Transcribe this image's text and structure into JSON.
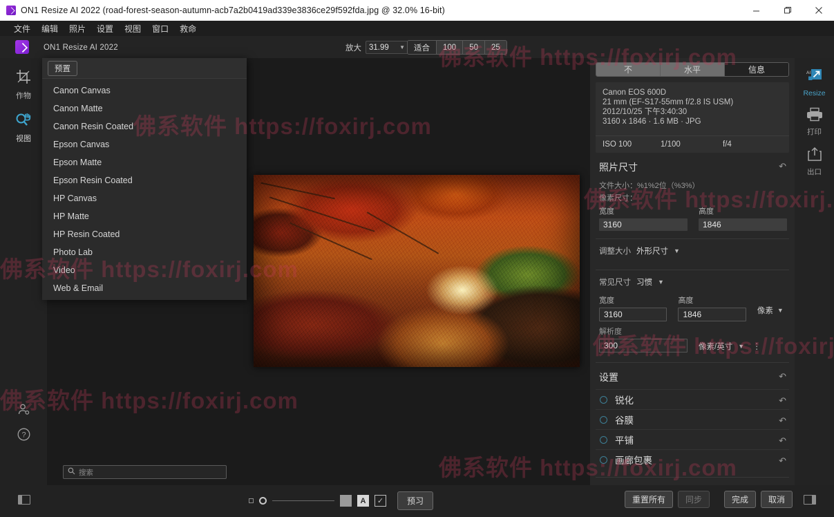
{
  "window": {
    "title": "ON1 Resize AI 2022 (road-forest-season-autumn-acb7a2b0419ad339e3836ce29f592fda.jpg @ 32.0% 16-bit)",
    "app_icon": "on1-logo-icon",
    "minimize": "─",
    "maximize": "❐",
    "close": "✕"
  },
  "menubar": {
    "items": [
      {
        "label": "文件"
      },
      {
        "label": "编辑"
      },
      {
        "label": "照片"
      },
      {
        "label": "设置"
      },
      {
        "label": "视图"
      },
      {
        "label": "窗口"
      },
      {
        "label": "救命"
      }
    ]
  },
  "appheader": {
    "app_name": "ON1 Resize AI 2022",
    "zoom_label": "放大",
    "zoom_value": "31.99",
    "fit_buttons": [
      {
        "label": "适合",
        "active": true
      },
      {
        "label": "100",
        "active": false
      },
      {
        "label": "50",
        "active": false
      },
      {
        "label": "25",
        "active": false
      }
    ]
  },
  "toolrail": {
    "tools": [
      {
        "label": "作物",
        "icon": "crop-icon",
        "active": false
      },
      {
        "label": "视图",
        "icon": "pan-zoom-icon",
        "active": true
      }
    ],
    "bottom_icons": [
      {
        "name": "user-icon"
      },
      {
        "name": "help-icon"
      }
    ]
  },
  "presets": {
    "button_label": "预置",
    "items": [
      {
        "label": "Canon Canvas"
      },
      {
        "label": "Canon Matte"
      },
      {
        "label": "Canon Resin Coated"
      },
      {
        "label": "Epson Canvas"
      },
      {
        "label": "Epson Matte"
      },
      {
        "label": "Epson Resin Coated"
      },
      {
        "label": "HP Canvas"
      },
      {
        "label": "HP Matte"
      },
      {
        "label": "HP Resin Coated"
      },
      {
        "label": "Photo Lab"
      },
      {
        "label": "Video"
      },
      {
        "label": "Web & Email"
      }
    ]
  },
  "search": {
    "placeholder": "搜索",
    "value": ""
  },
  "rightpanel": {
    "tabs": [
      {
        "label": "不",
        "active": false
      },
      {
        "label": "水平",
        "active": false
      },
      {
        "label": "信息",
        "active": true
      }
    ],
    "info": {
      "camera": "Canon EOS 600D",
      "lens": "21 mm (EF-S17-55mm f/2.8 IS USM)",
      "datetime": "2012/10/25 下午3:40:30",
      "dimensions": "3160 x 1846 · 1.6 MB · JPG",
      "iso": "ISO 100",
      "shutter": "1/100",
      "aperture": "f/4"
    },
    "photo_size": {
      "title": "照片尺寸",
      "reset_icon": "reset-icon",
      "file_size_label": "文件大小：%1%2位（%3%）",
      "pixel_dims_label": "像素尺寸：",
      "width_label": "宽度",
      "height_label": "高度",
      "width_value": "3160",
      "height_value": "1846",
      "resize_label": "调整大小",
      "resize_value": "外形尺寸",
      "common_label": "常见尺寸",
      "common_value": "习惯",
      "out_width_label": "宽度",
      "out_height_label": "高度",
      "out_width_value": "3160",
      "out_height_value": "1846",
      "unit_value": "像素",
      "resolution_label": "解析度",
      "resolution_value": "300",
      "resolution_unit": "像素/英寸",
      "more_icon": "kebab-menu-icon"
    },
    "settings": {
      "title": "设置",
      "rows": [
        {
          "label": "锐化"
        },
        {
          "label": "谷膜"
        },
        {
          "label": "平铺"
        },
        {
          "label": "画廊包裹"
        }
      ]
    }
  },
  "modrail": {
    "modules": [
      {
        "label": "Resize",
        "icon": "ai-resize-icon",
        "active": true
      },
      {
        "label": "打印",
        "icon": "printer-icon",
        "active": false
      },
      {
        "label": "出口",
        "icon": "export-icon",
        "active": false
      }
    ]
  },
  "bottombar": {
    "left_panel_toggle": "left-panel-toggle-icon",
    "right_panel_toggle": "right-panel-toggle-icon",
    "soft_proof_icon": "soft-proof-icon",
    "text_icon": "A",
    "check_icon": "✓",
    "preview_label": "预习",
    "reset_all_label": "重置所有",
    "sync_label": "同步",
    "done_label": "完成",
    "cancel_label": "取消"
  },
  "watermarks": [
    {
      "text": "佛系软件 https://foxirj.com"
    },
    {
      "text": "佛系软件 https://foxirj.com"
    },
    {
      "text": "佛系软件 https://foxirj.com"
    },
    {
      "text": "佛系软件 https://foxirj.com"
    },
    {
      "text": "佛系软件 https://foxirj.com"
    }
  ],
  "colors": {
    "accent": "#4aa3c8",
    "brand_purple": "#8f2fd6",
    "panel_bg": "#282828",
    "watermark": "#c43c5a"
  }
}
